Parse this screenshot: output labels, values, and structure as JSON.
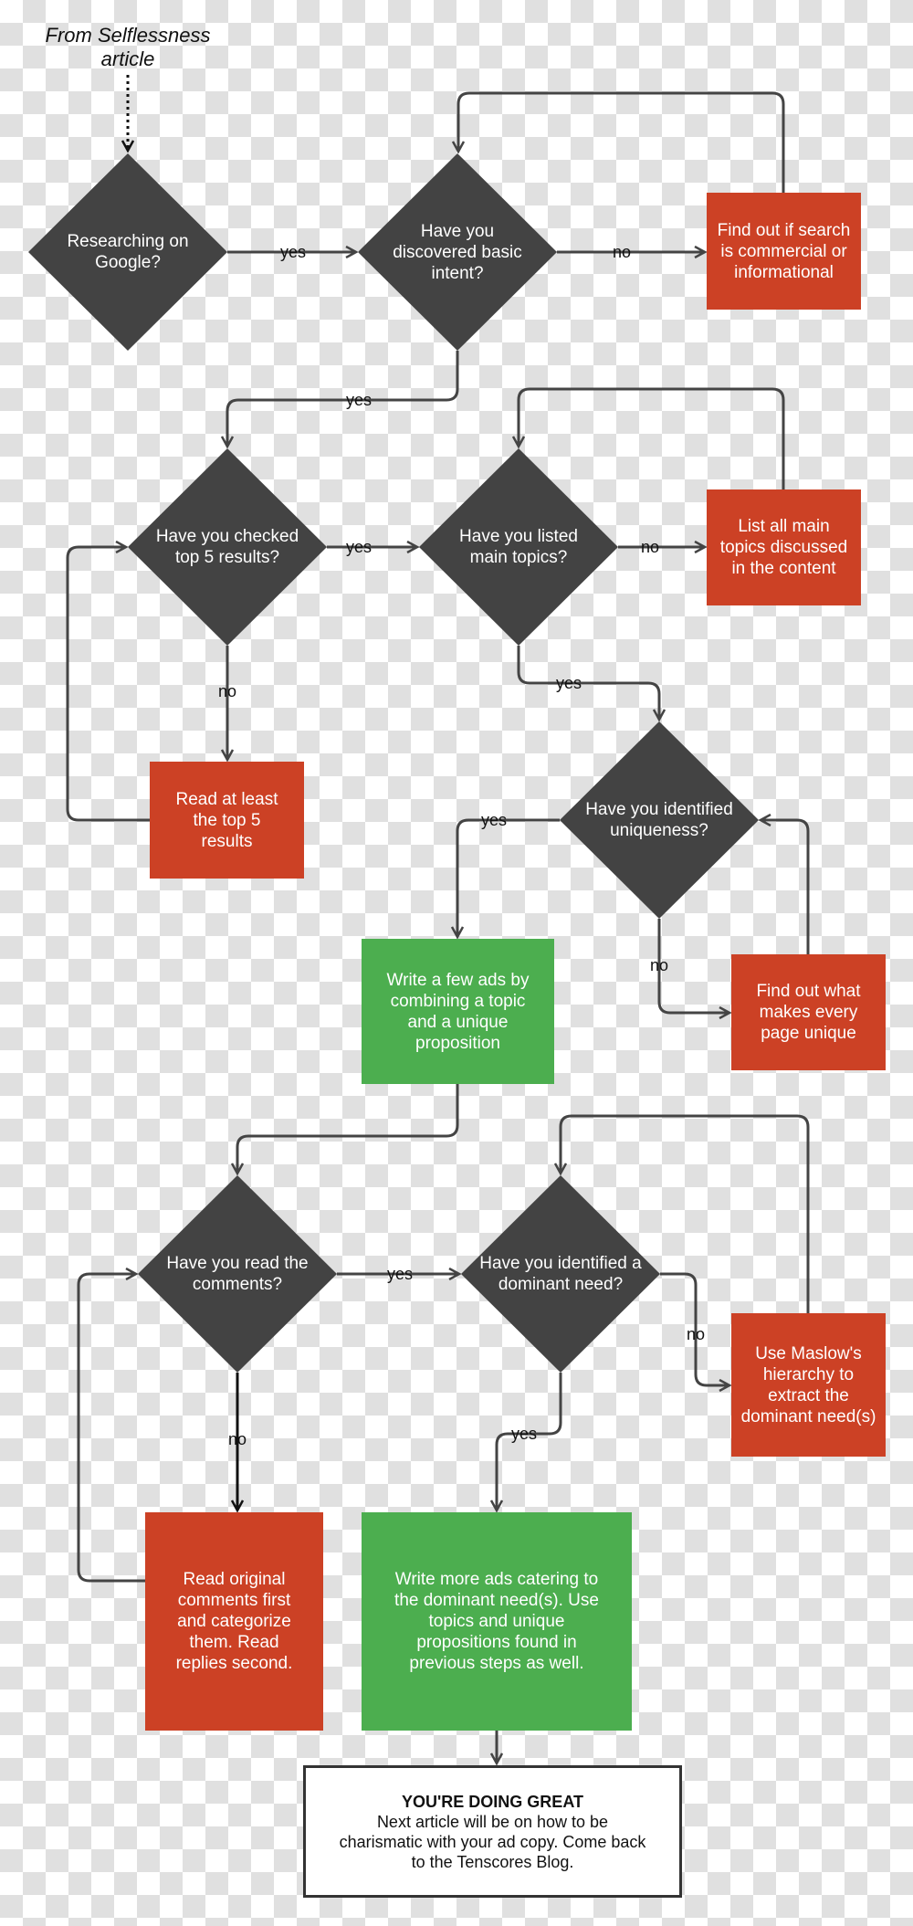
{
  "colors": {
    "decision": "#434343",
    "action": "#cc4125",
    "result": "#4cae4f",
    "connector": "#444444"
  },
  "caption": {
    "line1": "From Selflessness",
    "line2": "article"
  },
  "decisions": {
    "google": "Researching on Google?",
    "intent": "Have you discovered basic intent?",
    "top5": "Have you checked top 5 results?",
    "topics": "Have you listed main topics?",
    "uniqueness": "Have you identified uniqueness?",
    "comments": "Have you read the comments?",
    "dominant": "Have you identified a dominant need?"
  },
  "actions": {
    "commercial": "Find out if search is commercial or informational",
    "list_topics": "List all main topics discussed in the content",
    "read_top5": "Read at least the top 5 results",
    "unique_page": "Find out what makes every page unique",
    "maslow": "Use Maslow's hierarchy to extract the dominant need(s)",
    "read_comments": "Read original comments first and categorize them. Read replies second."
  },
  "results": {
    "write_ads": "Write a few ads by combining a topic and a unique proposition",
    "write_more_ads": "Write more ads catering to the dominant need(s). Use topics and unique propositions found in previous steps as well."
  },
  "final": {
    "title": "YOU'RE DOING GREAT",
    "body": "Next article will be on how to be charismatic with your ad copy. Come back to the Tenscores Blog."
  },
  "labels": {
    "yes": "yes",
    "no": "no"
  }
}
